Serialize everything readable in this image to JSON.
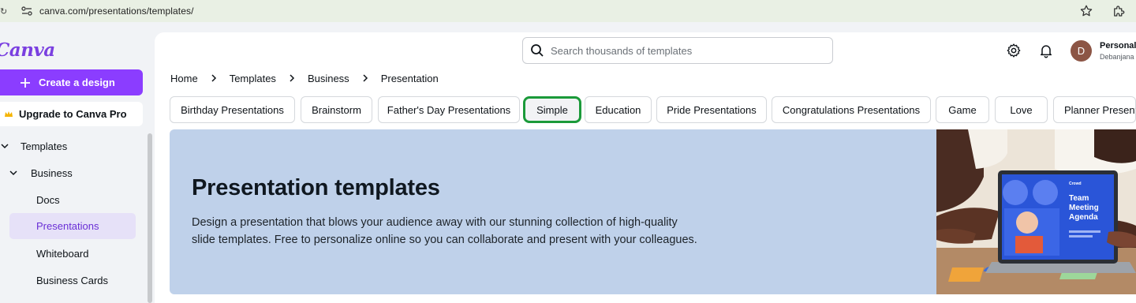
{
  "browser": {
    "url": "canva.com/presentations/templates/"
  },
  "sidebar": {
    "logo": "Canva",
    "create_label": "Create a design",
    "upgrade_label": "Upgrade to Canva Pro",
    "nav": {
      "templates": "Templates",
      "business": "Business",
      "docs": "Docs",
      "presentations": "Presentations",
      "whiteboard": "Whiteboard",
      "business_cards": "Business Cards"
    }
  },
  "header": {
    "search_placeholder": "Search thousands of templates",
    "account_name": "Personal",
    "account_user": "Debanjana",
    "avatar_initial": "D"
  },
  "breadcrumb": [
    "Home",
    "Templates",
    "Business",
    "Presentation"
  ],
  "chips": [
    "Birthday Presentations",
    "Brainstorm",
    "Father's Day Presentations",
    "Simple",
    "Education",
    "Pride Presentations",
    "Congratulations Presentations",
    "Game",
    "Love",
    "Planner Presentations"
  ],
  "selected_chip": "Simple",
  "banner": {
    "title": "Presentation templates",
    "description_line1": "Design a presentation that blows your audience away with our stunning collection of high-quality",
    "description_line2": "slide templates. Free to personalize online so you can collaborate and present with your colleagues.",
    "laptop_slide_title": [
      "Team",
      "Meeting",
      "Agenda"
    ],
    "laptop_slide_brand": "Crowd"
  },
  "colors": {
    "brand_purple": "#8b3dff",
    "selection_green": "#1b9a3a",
    "banner_bg": "#bfd1ea",
    "sidebar_active_bg": "#e6e1f8"
  }
}
